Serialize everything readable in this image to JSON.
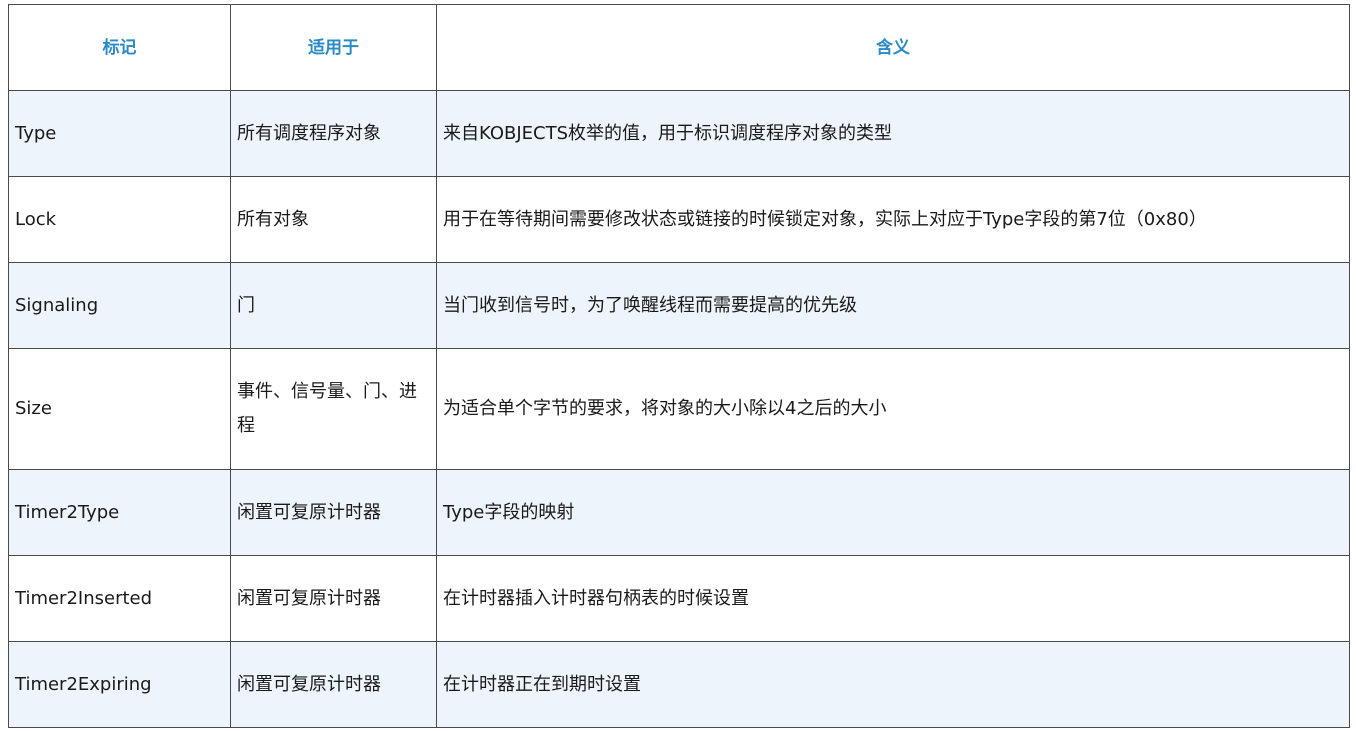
{
  "table": {
    "headers": [
      "标记",
      "适用于",
      "含义"
    ],
    "rows": [
      {
        "flag": "Type",
        "applies": "所有调度程序对象",
        "meaning": "来自KOBJECTS枚举的值，用于标识调度程序对象的类型"
      },
      {
        "flag": "Lock",
        "applies": "所有对象",
        "meaning": "用于在等待期间需要修改状态或链接的时候锁定对象，实际上对应于Type字段的第7位（0x80）"
      },
      {
        "flag": "Signaling",
        "applies": "门",
        "meaning": "当门收到信号时，为了唤醒线程而需要提高的优先级"
      },
      {
        "flag": "Size",
        "applies": "事件、信号量、门、进程",
        "meaning": "为适合单个字节的要求，将对象的大小除以4之后的大小"
      },
      {
        "flag": "Timer2Type",
        "applies": "闲置可复原计时器",
        "meaning": "Type字段的映射"
      },
      {
        "flag": "Timer2Inserted",
        "applies": "闲置可复原计时器",
        "meaning": "在计时器插入计时器句柄表的时候设置"
      },
      {
        "flag": "Timer2Expiring",
        "applies": "闲置可复原计时器",
        "meaning": "在计时器正在到期时设置"
      }
    ]
  }
}
